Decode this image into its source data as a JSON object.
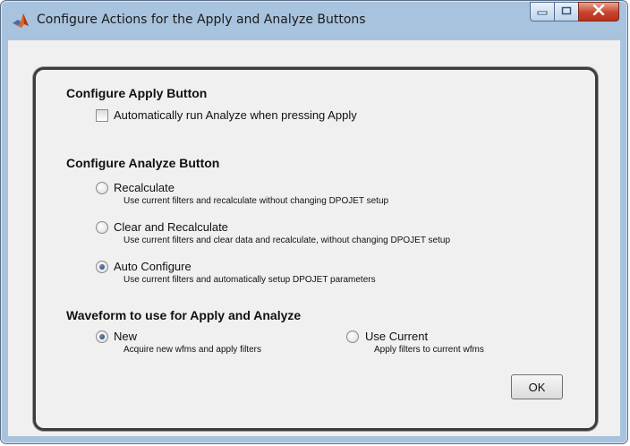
{
  "window": {
    "title": "Configure Actions for the Apply and Analyze Buttons"
  },
  "apply_section": {
    "heading": "Configure Apply Button",
    "checkbox_label": "Automatically run Analyze when pressing Apply",
    "checked": false
  },
  "analyze_section": {
    "heading": "Configure Analyze Button",
    "options": [
      {
        "label": "Recalculate",
        "desc": "Use current filters and recalculate without changing DPOJET setup",
        "selected": false
      },
      {
        "label": "Clear and Recalculate",
        "desc": "Use current filters and clear data and recalculate, without changing DPOJET setup",
        "selected": false
      },
      {
        "label": "Auto Configure",
        "desc": "Use current filters and automatically setup DPOJET parameters",
        "selected": true
      }
    ]
  },
  "waveform_section": {
    "heading": "Waveform to use for Apply and Analyze",
    "options": [
      {
        "label": "New",
        "desc": "Acquire new wfms and apply filters",
        "selected": true
      },
      {
        "label": "Use Current",
        "desc": "Apply filters to current wfms",
        "selected": false
      }
    ]
  },
  "buttons": {
    "ok": "OK"
  },
  "icons": {
    "app": "matlab-icon",
    "minimize": "minimize-icon",
    "maximize": "maximize-icon",
    "close": "close-icon"
  },
  "colors": {
    "titlebar": "#a8c3de",
    "close": "#c7432c",
    "radio_dot": "#1d3f74"
  }
}
